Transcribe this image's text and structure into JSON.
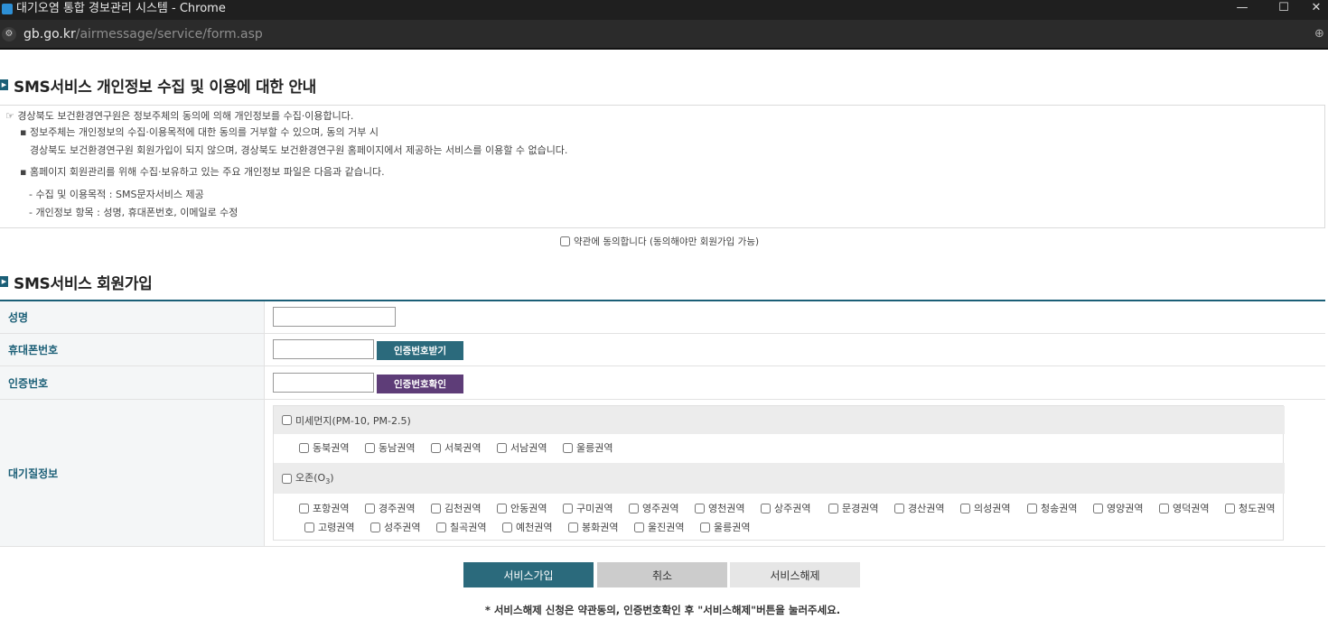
{
  "window": {
    "title": "대기오염 통합 경보관리 시스템 - Chrome",
    "minimize": "—",
    "maximize": "☐",
    "close": "✕"
  },
  "addressbar": {
    "host": "gb.go.kr",
    "path": "/airmessage/service/form.asp"
  },
  "privacy": {
    "heading": "SMS서비스 개인정보 수집 및 이용에 대한 안내",
    "intro": "☞ 경상북도 보건환경연구원은 정보주체의 동의에 의해 개인정보를 수집·이용합니다.",
    "bullet1_a": "▪ 정보주체는 개인정보의 수집·이용목적에 대한 동의를 거부할 수 있으며, 동의 거부 시",
    "bullet1_b": "경상북도 보건환경연구원 회원가입이 되지 않으며, 경상북도 보건환경연구원 홈페이지에서 제공하는 서비스를 이용할 수 없습니다.",
    "bullet2": "▪ 홈페이지 회원관리를 위해 수집·보유하고 있는 주요 개인정보 파일은 다음과 같습니다.",
    "dash1": "- 수집 및 이용목적 : SMS문자서비스 제공",
    "dash2": "- 개인정보 항목 : 성명, 휴대폰번호, 이메일로 수정",
    "agree_label": "약관에 동의합니다 (동의해야만 회원가입 가능)"
  },
  "signup": {
    "heading": "SMS서비스 회원가입",
    "name_label": "성명",
    "phone_label": "휴대폰번호",
    "phone_button": "인증번호받기",
    "auth_label": "인증번호",
    "auth_button": "인증번호확인",
    "air_label": "대기질정보",
    "pm_label": "미세먼지(PM-10, PM-2.5)",
    "pm_regions": [
      "동북권역",
      "동남권역",
      "서북권역",
      "서남권역",
      "울릉권역"
    ],
    "ozone_label": "오존(O",
    "ozone_sub": "3",
    "ozone_close": ")",
    "ozone_regions_row1": [
      "포항권역",
      "경주권역",
      "김천권역",
      "안동권역",
      "구미권역",
      "영주권역",
      "영천권역",
      "상주권역",
      "문경권역",
      "경산권역",
      "의성권역",
      "청송권역",
      "영양권역",
      "영덕권역",
      "청도권역"
    ],
    "ozone_regions_row2": [
      "고령권역",
      "성주권역",
      "칠곡권역",
      "예천권역",
      "봉화권역",
      "울진권역",
      "울릉권역"
    ]
  },
  "actions": {
    "join": "서비스가입",
    "cancel": "취소",
    "unsubscribe": "서비스해제"
  },
  "notice": "* 서비스해제 신청은 약관동의, 인증번호확인 후 \"서비스해제\"버튼을 눌러주세요.",
  "colors": {
    "primary": "#2b6a7c",
    "auth_button": "#5e3d78",
    "cancel": "#cccccc",
    "unsubscribe": "#e6e6e6"
  }
}
